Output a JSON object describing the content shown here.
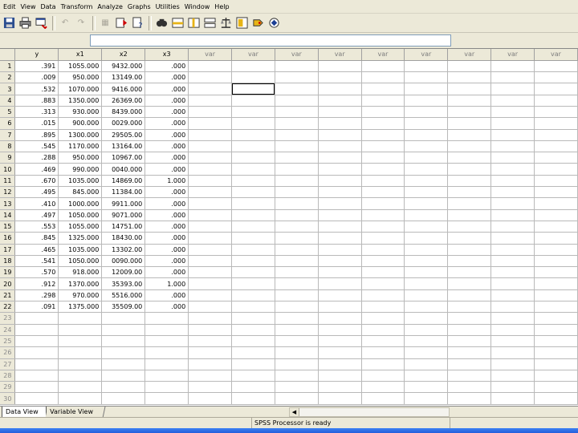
{
  "menu": [
    "Edit",
    "View",
    "Data",
    "Transform",
    "Analyze",
    "Graphs",
    "Utilities",
    "Window",
    "Help"
  ],
  "toolbar": {
    "buttons": [
      {
        "name": "save-icon",
        "glyph": "",
        "disabled": false
      },
      {
        "name": "print-icon",
        "glyph": "",
        "disabled": false
      },
      {
        "name": "dialog-recall-icon",
        "glyph": "",
        "disabled": false
      },
      {
        "name": "undo-icon",
        "glyph": "↶",
        "disabled": true
      },
      {
        "name": "redo-icon",
        "glyph": "↷",
        "disabled": true
      },
      {
        "name": "goto-chart-icon",
        "glyph": "▦",
        "disabled": true
      },
      {
        "name": "goto-case-icon",
        "glyph": "",
        "disabled": false
      },
      {
        "name": "variables-icon",
        "glyph": "",
        "disabled": false
      },
      {
        "name": "find-icon",
        "glyph": "",
        "disabled": false
      },
      {
        "name": "insert-cases-icon",
        "glyph": "",
        "disabled": false
      },
      {
        "name": "insert-variable-icon",
        "glyph": "",
        "disabled": false
      },
      {
        "name": "split-file-icon",
        "glyph": "",
        "disabled": false
      },
      {
        "name": "weight-cases-icon",
        "glyph": "",
        "disabled": false
      },
      {
        "name": "select-cases-icon",
        "glyph": "",
        "disabled": false
      },
      {
        "name": "value-labels-icon",
        "glyph": "",
        "disabled": false
      },
      {
        "name": "use-sets-icon",
        "glyph": "",
        "disabled": false
      }
    ]
  },
  "editor": {
    "value": ""
  },
  "grid": {
    "columns": [
      "y",
      "x1",
      "x2",
      "x3",
      "var",
      "var",
      "var",
      "var",
      "var",
      "var",
      "var",
      "var",
      "var"
    ],
    "rows": [
      [
        "1",
        ".391",
        "1055.000",
        "9432.000",
        ".000"
      ],
      [
        "2",
        ".009",
        "950.000",
        "13149.00",
        ".000"
      ],
      [
        "3",
        ".532",
        "1070.000",
        "9416.000",
        ".000"
      ],
      [
        "4",
        ".883",
        "1350.000",
        "26369.00",
        ".000"
      ],
      [
        "5",
        ".313",
        "930.000",
        "8439.000",
        ".000"
      ],
      [
        "6",
        ".015",
        "900.000",
        "0029.000",
        ".000"
      ],
      [
        "7",
        ".895",
        "1300.000",
        "29505.00",
        ".000"
      ],
      [
        "8",
        ".545",
        "1170.000",
        "13164.00",
        ".000"
      ],
      [
        "9",
        ".288",
        "950.000",
        "10967.00",
        ".000"
      ],
      [
        "10",
        ".469",
        "990.000",
        "0040.000",
        ".000"
      ],
      [
        "11",
        ".670",
        "1035.000",
        "14869.00",
        "1.000"
      ],
      [
        "12",
        ".495",
        "845.000",
        "11384.00",
        ".000"
      ],
      [
        "13",
        ".410",
        "1000.000",
        "9911.000",
        ".000"
      ],
      [
        "14",
        ".497",
        "1050.000",
        "9071.000",
        ".000"
      ],
      [
        "15",
        ".553",
        "1055.000",
        "14751.00",
        ".000"
      ],
      [
        "16",
        ".845",
        "1325.000",
        "18430.00",
        ".000"
      ],
      [
        "17",
        ".465",
        "1035.000",
        "13302.00",
        ".000"
      ],
      [
        "18",
        ".541",
        "1050.000",
        "0090.000",
        ".000"
      ],
      [
        "19",
        ".570",
        "918.000",
        "12009.00",
        ".000"
      ],
      [
        "20",
        ".912",
        "1370.000",
        "35393.00",
        "1.000"
      ],
      [
        "21",
        ".298",
        "970.000",
        "5516.000",
        ".000"
      ],
      [
        "22",
        ".091",
        "1375.000",
        "35509.00",
        ".000"
      ]
    ],
    "empty_rows": [
      "23",
      "24",
      "25",
      "26",
      "27",
      "28",
      "29",
      "30"
    ]
  },
  "tabs": {
    "data_view": "Data View",
    "variable_view": "Variable View"
  },
  "status": {
    "text": "SPSS Processor  is ready"
  }
}
